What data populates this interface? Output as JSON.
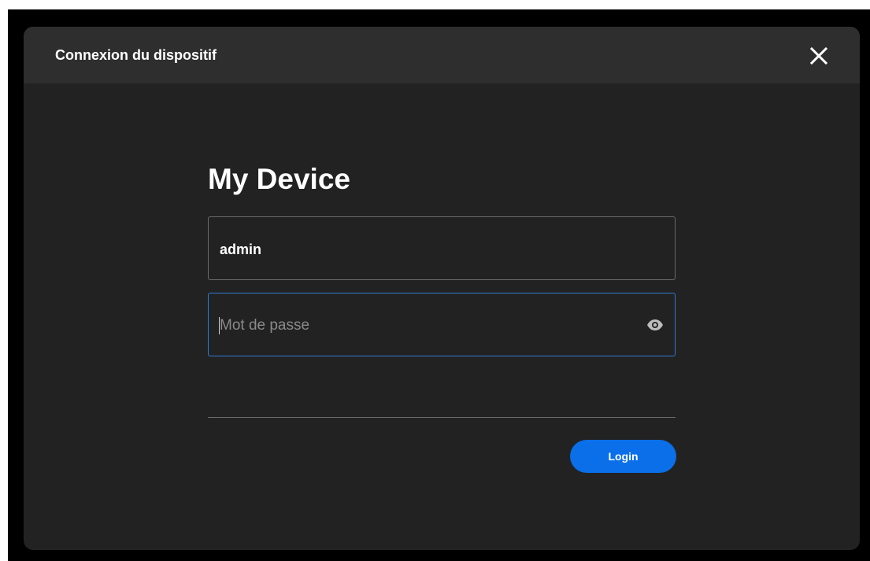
{
  "dialog": {
    "title": "Connexion du dispositif",
    "close_icon": "close-icon"
  },
  "login": {
    "device_name": "My Device",
    "username": {
      "value": "admin"
    },
    "password": {
      "value": "",
      "placeholder": "Mot de passe",
      "visibility_icon": "eye-icon"
    },
    "submit_label": "Login"
  },
  "colors": {
    "accent": "#0a6fe8",
    "focus_border": "#2f7bd6",
    "dialog_bg": "#222222",
    "titlebar_bg": "#2e2e2e"
  }
}
